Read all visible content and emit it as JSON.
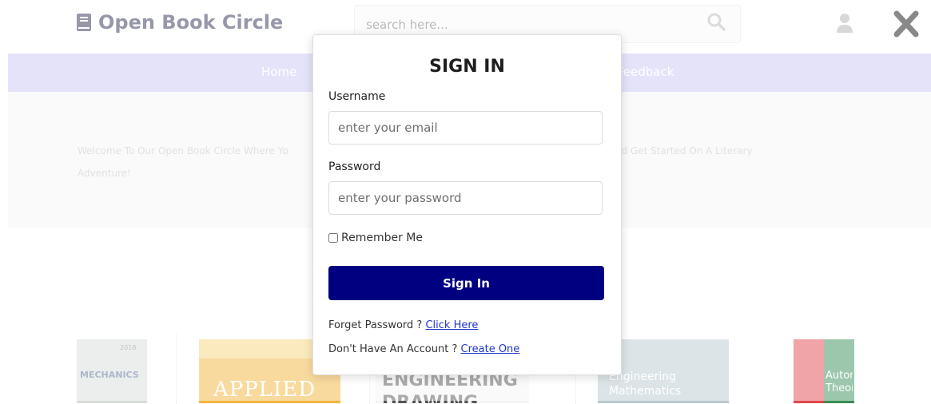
{
  "header": {
    "logo_text": "Open Book Circle",
    "search_placeholder": "search here...",
    "accent": "#2f2f56"
  },
  "nav": {
    "items": [
      "Home",
      "Feedback"
    ],
    "color": "#c9c6f3"
  },
  "hero": {
    "text_left": "Welcome To Our Open Book Circle Where Yo",
    "text_right": "Collection And Get Started On A Literary",
    "text_line2": "Adventure!"
  },
  "books": [
    {
      "title": "MECHANICS",
      "year": "2018"
    },
    {
      "title": "APPLIED"
    },
    {
      "title": "ENGINEERING DRAWING"
    },
    {
      "title": "Engineering Mathematics"
    },
    {
      "title": "Automata Theory"
    }
  ],
  "modal": {
    "title": "SIGN IN",
    "username_label": "Username",
    "username_placeholder": "enter your email",
    "password_label": "Password",
    "password_placeholder": "enter your password",
    "remember_label": "Remember Me",
    "signin_label": "Sign In",
    "forget_text": "Forget Password ?",
    "forget_link": "Click Here",
    "account_text": "Don't Have An Account ?",
    "account_link": "Create One",
    "button_color": "#000080"
  }
}
